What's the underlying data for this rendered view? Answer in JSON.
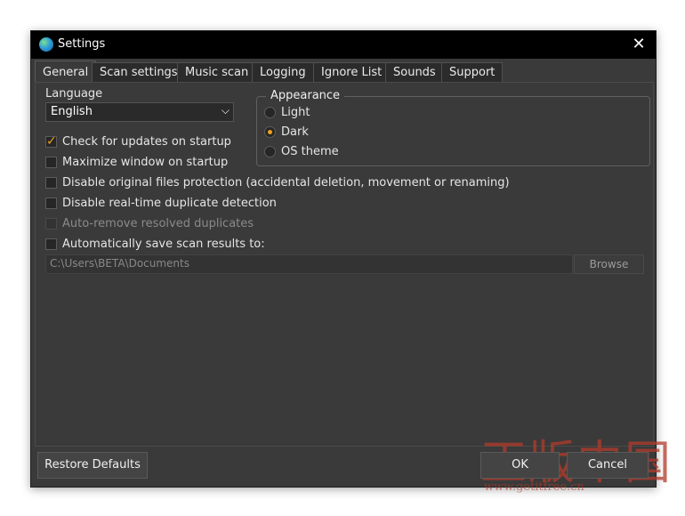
{
  "window": {
    "title": "Settings",
    "close_glyph": "✕"
  },
  "tabs": [
    {
      "label": "General",
      "active": true
    },
    {
      "label": "Scan settings"
    },
    {
      "label": "Music scan"
    },
    {
      "label": "Logging"
    },
    {
      "label": "Ignore List"
    },
    {
      "label": "Sounds"
    },
    {
      "label": "Support"
    }
  ],
  "general": {
    "language_label": "Language",
    "language_value": "English",
    "appearance": {
      "title": "Appearance",
      "options": [
        {
          "label": "Light",
          "selected": false
        },
        {
          "label": "Dark",
          "selected": true
        },
        {
          "label": "OS theme",
          "selected": false
        }
      ]
    },
    "checkboxes": [
      {
        "label": "Check for updates on startup",
        "checked": true,
        "enabled": true
      },
      {
        "label": "Maximize window on startup",
        "checked": false,
        "enabled": true
      },
      {
        "label": "Disable original files protection (accidental deletion, movement or renaming)",
        "checked": false,
        "enabled": true
      },
      {
        "label": "Disable real-time duplicate detection",
        "checked": false,
        "enabled": true
      },
      {
        "label": "Auto-remove resolved duplicates",
        "checked": false,
        "enabled": false
      },
      {
        "label": "Automatically save scan results to:",
        "checked": false,
        "enabled": true
      }
    ],
    "save_path": "C:\\Users\\BETA\\Documents",
    "browse_label": "Browse"
  },
  "footer": {
    "restore_label": "Restore Defaults",
    "ok_label": "OK",
    "cancel_label": "Cancel"
  },
  "watermark": {
    "text": "正版中国",
    "url": "www.getitfree.cn"
  },
  "colors": {
    "accent": "#f0a020",
    "window_bg": "#3a3a3a",
    "titlebar_bg": "#000000"
  },
  "icons": {
    "app": "globe-icon",
    "close": "close-icon",
    "dropdown": "chevron-down-icon",
    "check": "checkmark-icon"
  }
}
